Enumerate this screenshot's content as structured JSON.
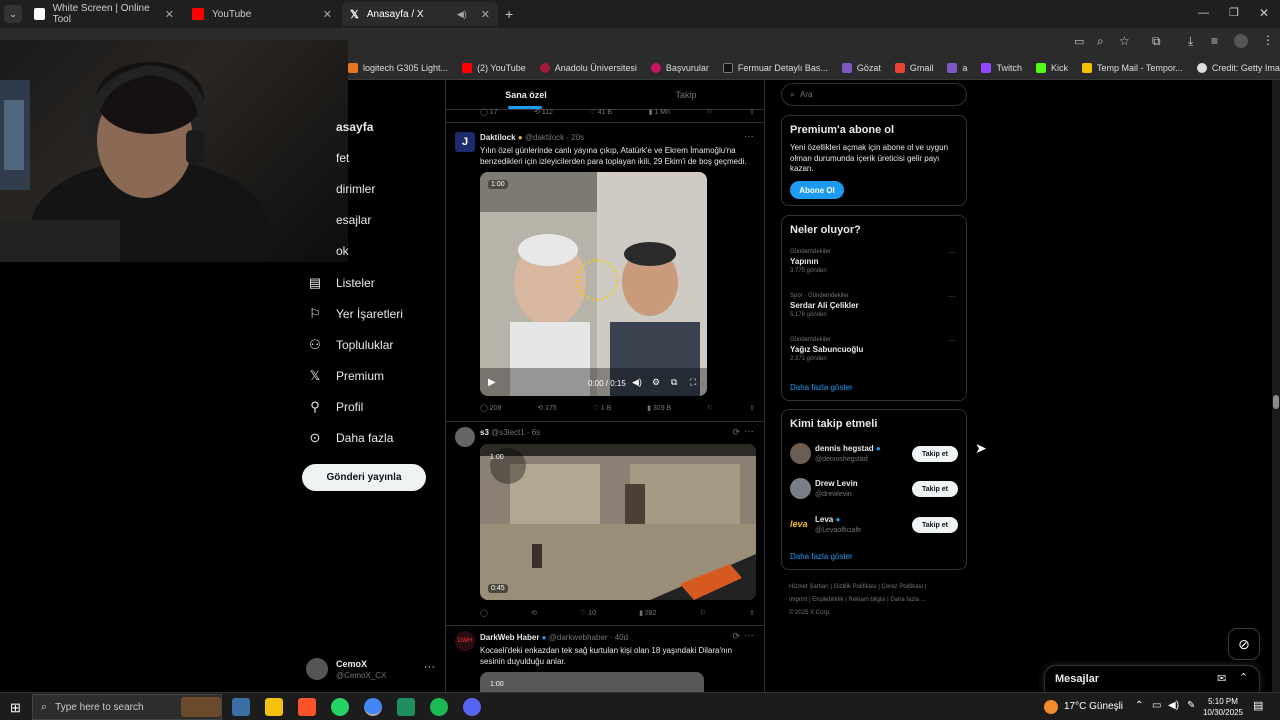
{
  "browser": {
    "tabs": [
      {
        "title": "White Screen | Online Tool"
      },
      {
        "title": "YouTube"
      },
      {
        "title": "Anasayfa / X"
      }
    ],
    "bookmarks": [
      "logitech G305 Light...",
      "(2) YouTube",
      "Anadolu Üniversitesi",
      "Başvurular",
      "Fermuar Detaylı Bas...",
      "Gözat",
      "Gmail",
      "a",
      "Twitch",
      "Kick",
      "Temp Mail - Tempor...",
      "Credit: Getty Image..."
    ]
  },
  "sidebar": {
    "items": [
      {
        "label": "asayfa",
        "icon": "home-icon"
      },
      {
        "label": "fet",
        "icon": "explore-icon"
      },
      {
        "label": "dirimler",
        "icon": "bell-icon"
      },
      {
        "label": "esajlar",
        "icon": "mail-icon"
      },
      {
        "label": "ok",
        "icon": "grok-icon"
      },
      {
        "label": "Listeler",
        "icon": "list-icon"
      },
      {
        "label": "Yer İşaretleri",
        "icon": "bookmark-icon"
      },
      {
        "label": "Topluluklar",
        "icon": "people-icon"
      },
      {
        "label": "Premium",
        "icon": "x-logo-icon"
      },
      {
        "label": "Profil",
        "icon": "person-icon"
      },
      {
        "label": "Daha fazla",
        "icon": "more-circle-icon"
      }
    ],
    "post_button": "Gönderi yayınla",
    "account": {
      "name": "CemoX",
      "handle": "@CemoX_CX"
    }
  },
  "feed": {
    "tabs": [
      "Sana özel",
      "Takip"
    ],
    "top_actions": [
      "17",
      "112",
      "41 B",
      "1 Mn"
    ],
    "tweets": [
      {
        "name": "Daktilock",
        "handle": "@daktilock",
        "time": "20s",
        "text": "Yılın özel günlerinde canlı yayına çıkıp, Atatürk'e ve Ekrem İmamoğlu'na benzedikleri için izleyicilerden para toplayan ikili, 29 Ekim'i de boş geçmedi.",
        "video_time": "0:00 / 0:15",
        "video_badge": "1:00",
        "actions": [
          "208",
          "175",
          "1 B",
          "309 B"
        ]
      },
      {
        "name": "s3",
        "handle": "@s3lect1",
        "time": "6s",
        "text": "",
        "video_time": "0:45",
        "video_badge": "1:00",
        "actions": [
          "",
          "",
          "10",
          "282"
        ]
      },
      {
        "name": "DarkWeb Haber",
        "handle": "@darkwebhaber",
        "time": "40d",
        "text": "Kocaeli'deki enkazdan tek sağ kurtulan kişi olan 18 yaşındaki Dilara'nın sesinin duyulduğu anlar.",
        "video_badge": "1:00"
      }
    ]
  },
  "right": {
    "search_placeholder": "Ara",
    "premium": {
      "title": "Premium'a abone ol",
      "text": "Yeni özellikleri açmak için abone ol ve uygun olman durumunda içerik üreticisi gelir payı kazan.",
      "button": "Abone Ol"
    },
    "trends": {
      "title": "Neler oluyor?",
      "items": [
        {
          "category": "Gündemdekiler",
          "name": "Yapının",
          "count": "3.775 gönderi"
        },
        {
          "category": "Spor · Gündemdekiler",
          "name": "Serdar Ali Çelikler",
          "count": "5.178 gönderi"
        },
        {
          "category": "Gündemdekiler",
          "name": "Yağız Sabuncuoğlu",
          "count": "2.371 gönderi"
        }
      ],
      "show_more": "Daha fazla göster"
    },
    "who_to_follow": {
      "title": "Kimi takip etmeli",
      "users": [
        {
          "name": "dennis hegstad",
          "handle": "@dennishegstad",
          "button": "Takip et"
        },
        {
          "name": "Drew Levin",
          "handle": "@drewlevin",
          "button": "Takip et"
        },
        {
          "name": "Leva",
          "handle": "@Levaofficialtr",
          "button": "Takip et"
        }
      ],
      "show_more": "Daha fazla göster"
    },
    "footer": [
      "Hizmet Şartları",
      "Gizlilik Politikası",
      "Çerez Politikası",
      "Imprint",
      "Erişilebilirlik",
      "Reklam bilgisi",
      "Daha fazla ...",
      "© 2025 X Corp."
    ]
  },
  "messages_bar": {
    "label": "Mesajlar"
  },
  "taskbar": {
    "search_placeholder": "Type here to search",
    "weather": "17°C Güneşli",
    "time": "5:10 PM",
    "date": "10/30/2025"
  },
  "colors": {
    "accent": "#1d9bf0",
    "background": "#000000",
    "border": "#2f3336"
  }
}
